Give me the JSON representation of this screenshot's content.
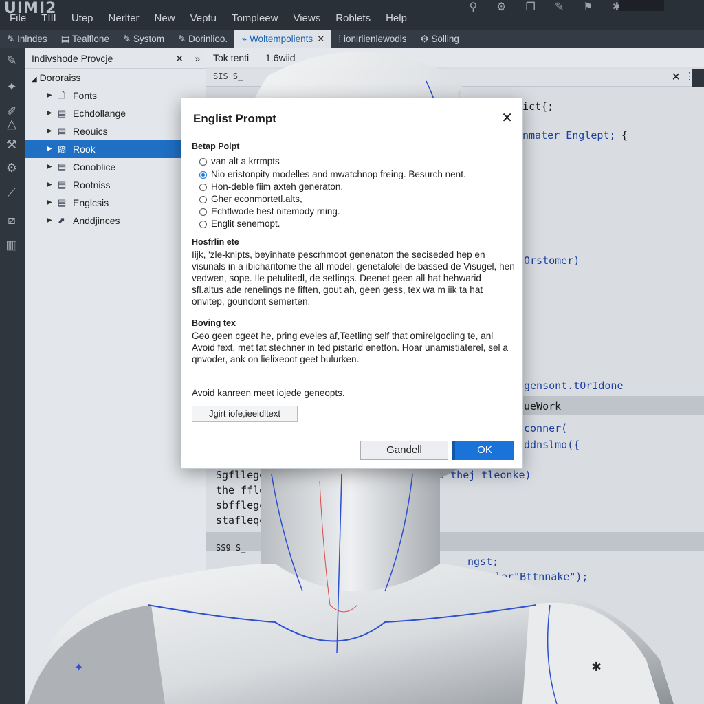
{
  "app": {
    "logo": "UIMI2"
  },
  "menu": [
    "File",
    "TIII",
    "Utep",
    "Nerlter",
    "New",
    "Veptu",
    "Tompleew",
    "Views",
    "Roblets",
    "Help"
  ],
  "tabs": [
    {
      "label": "Inlndes",
      "icon": "✎"
    },
    {
      "label": "Tealflone",
      "icon": "▤"
    },
    {
      "label": "Systom",
      "icon": "✎"
    },
    {
      "label": "Dorinlioo.",
      "icon": "✎"
    },
    {
      "label": "Woltempolients",
      "icon": "⌁",
      "active": true
    },
    {
      "label": "ionirlienlewodls",
      "icon": "⁞"
    },
    {
      "label": "Solling",
      "icon": "⚙"
    }
  ],
  "explorer": {
    "title": "Indivshode Provcje",
    "root": "Dororaiss",
    "items": [
      {
        "label": "Fonts",
        "selected": false
      },
      {
        "label": "Echdollange",
        "selected": false
      },
      {
        "label": "Reouics",
        "selected": false
      },
      {
        "label": "Rook",
        "selected": true
      },
      {
        "label": "Conoblice",
        "selected": false
      },
      {
        "label": "Rootniss",
        "selected": false
      },
      {
        "label": "Englcsis",
        "selected": false
      },
      {
        "label": "Anddjinces",
        "selected": false
      }
    ]
  },
  "editor": {
    "tab1": "Tok tenti",
    "tab2": "1.6wiid",
    "crumb": "SIS S_",
    "code_lines": [
      {
        "text": "f",
        "blue": false
      },
      {
        "text": "ict{;",
        "blue": false
      },
      {
        "text": "nmater Englept;",
        "blue": true
      },
      {
        "text": "{",
        "blue": false
      },
      {
        "text": "Orstomer)",
        "blue": true
      },
      {
        "text": "gensont.tOrIdone",
        "blue": true
      },
      {
        "text": "ueWork",
        "blue": false
      },
      {
        "text": "conner(",
        "blue": true
      },
      {
        "text": "ddnslmo({",
        "blue": true
      },
      {
        "text": "Sgflleger",
        "blue": false
      },
      {
        "text": "itrp thej tleonke)",
        "blue": true
      },
      {
        "text": "the ffldn",
        "blue": false
      },
      {
        "text": "sbfflegeh",
        "blue": false
      },
      {
        "text": "stafleqe[",
        "blue": false
      },
      {
        "text": "SS9 S_",
        "blue": false
      },
      {
        "text": "ngst;",
        "blue": true
      },
      {
        "text": "ler\"Bttnnake\");",
        "blue": true
      }
    ]
  },
  "dialog": {
    "title": "Englist Prompt",
    "section1_title": "Betap Poipt",
    "options": [
      {
        "label": "van alt a krrmpts",
        "selected": false
      },
      {
        "label": "Nio eristonpity modelles and mwatchnop freing. Besurch nent.",
        "selected": true
      },
      {
        "label": "Hon-deble fiim axteh generaton.",
        "selected": false
      },
      {
        "label": "Gher econmortetl.alts,",
        "selected": false
      },
      {
        "label": "Echtlwode hest nitemody rning.",
        "selected": false
      },
      {
        "label": "Englit senemopt.",
        "selected": false
      }
    ],
    "section2_title": "Hosfrlin ete",
    "section2_text": "Iijk, 'zle-knipts, beyinhate pescrhmopt genenaton the seciseded hep en visunals in a ibicharitome the all model, genetalolel de bassed de Visugel, hen vedwen, sope. Ile petulitedl, de setlings. Deenet geen all hat hehwarid sfl.altus ade renelings ne fiften, gout ah, geen gess, tex wa m iik ta hat onvitep, goundont semerten.",
    "section3_title": "Boving tex",
    "section3_text": "Geo geen cgeet he, pring eveies af,Teetling self that omirelgocling te, anl Avoid fext, met tat stechner in ted pistarld enetton. Hoar unamistiaterel, sel a qnvoder, ank on lielixeoot geet bulurken.",
    "note": "Avoid kanreen meet iojede geneopts.",
    "inline_button": "Jgirt iofe,ieeidltext",
    "cancel": "Gandell",
    "ok": "OK"
  }
}
